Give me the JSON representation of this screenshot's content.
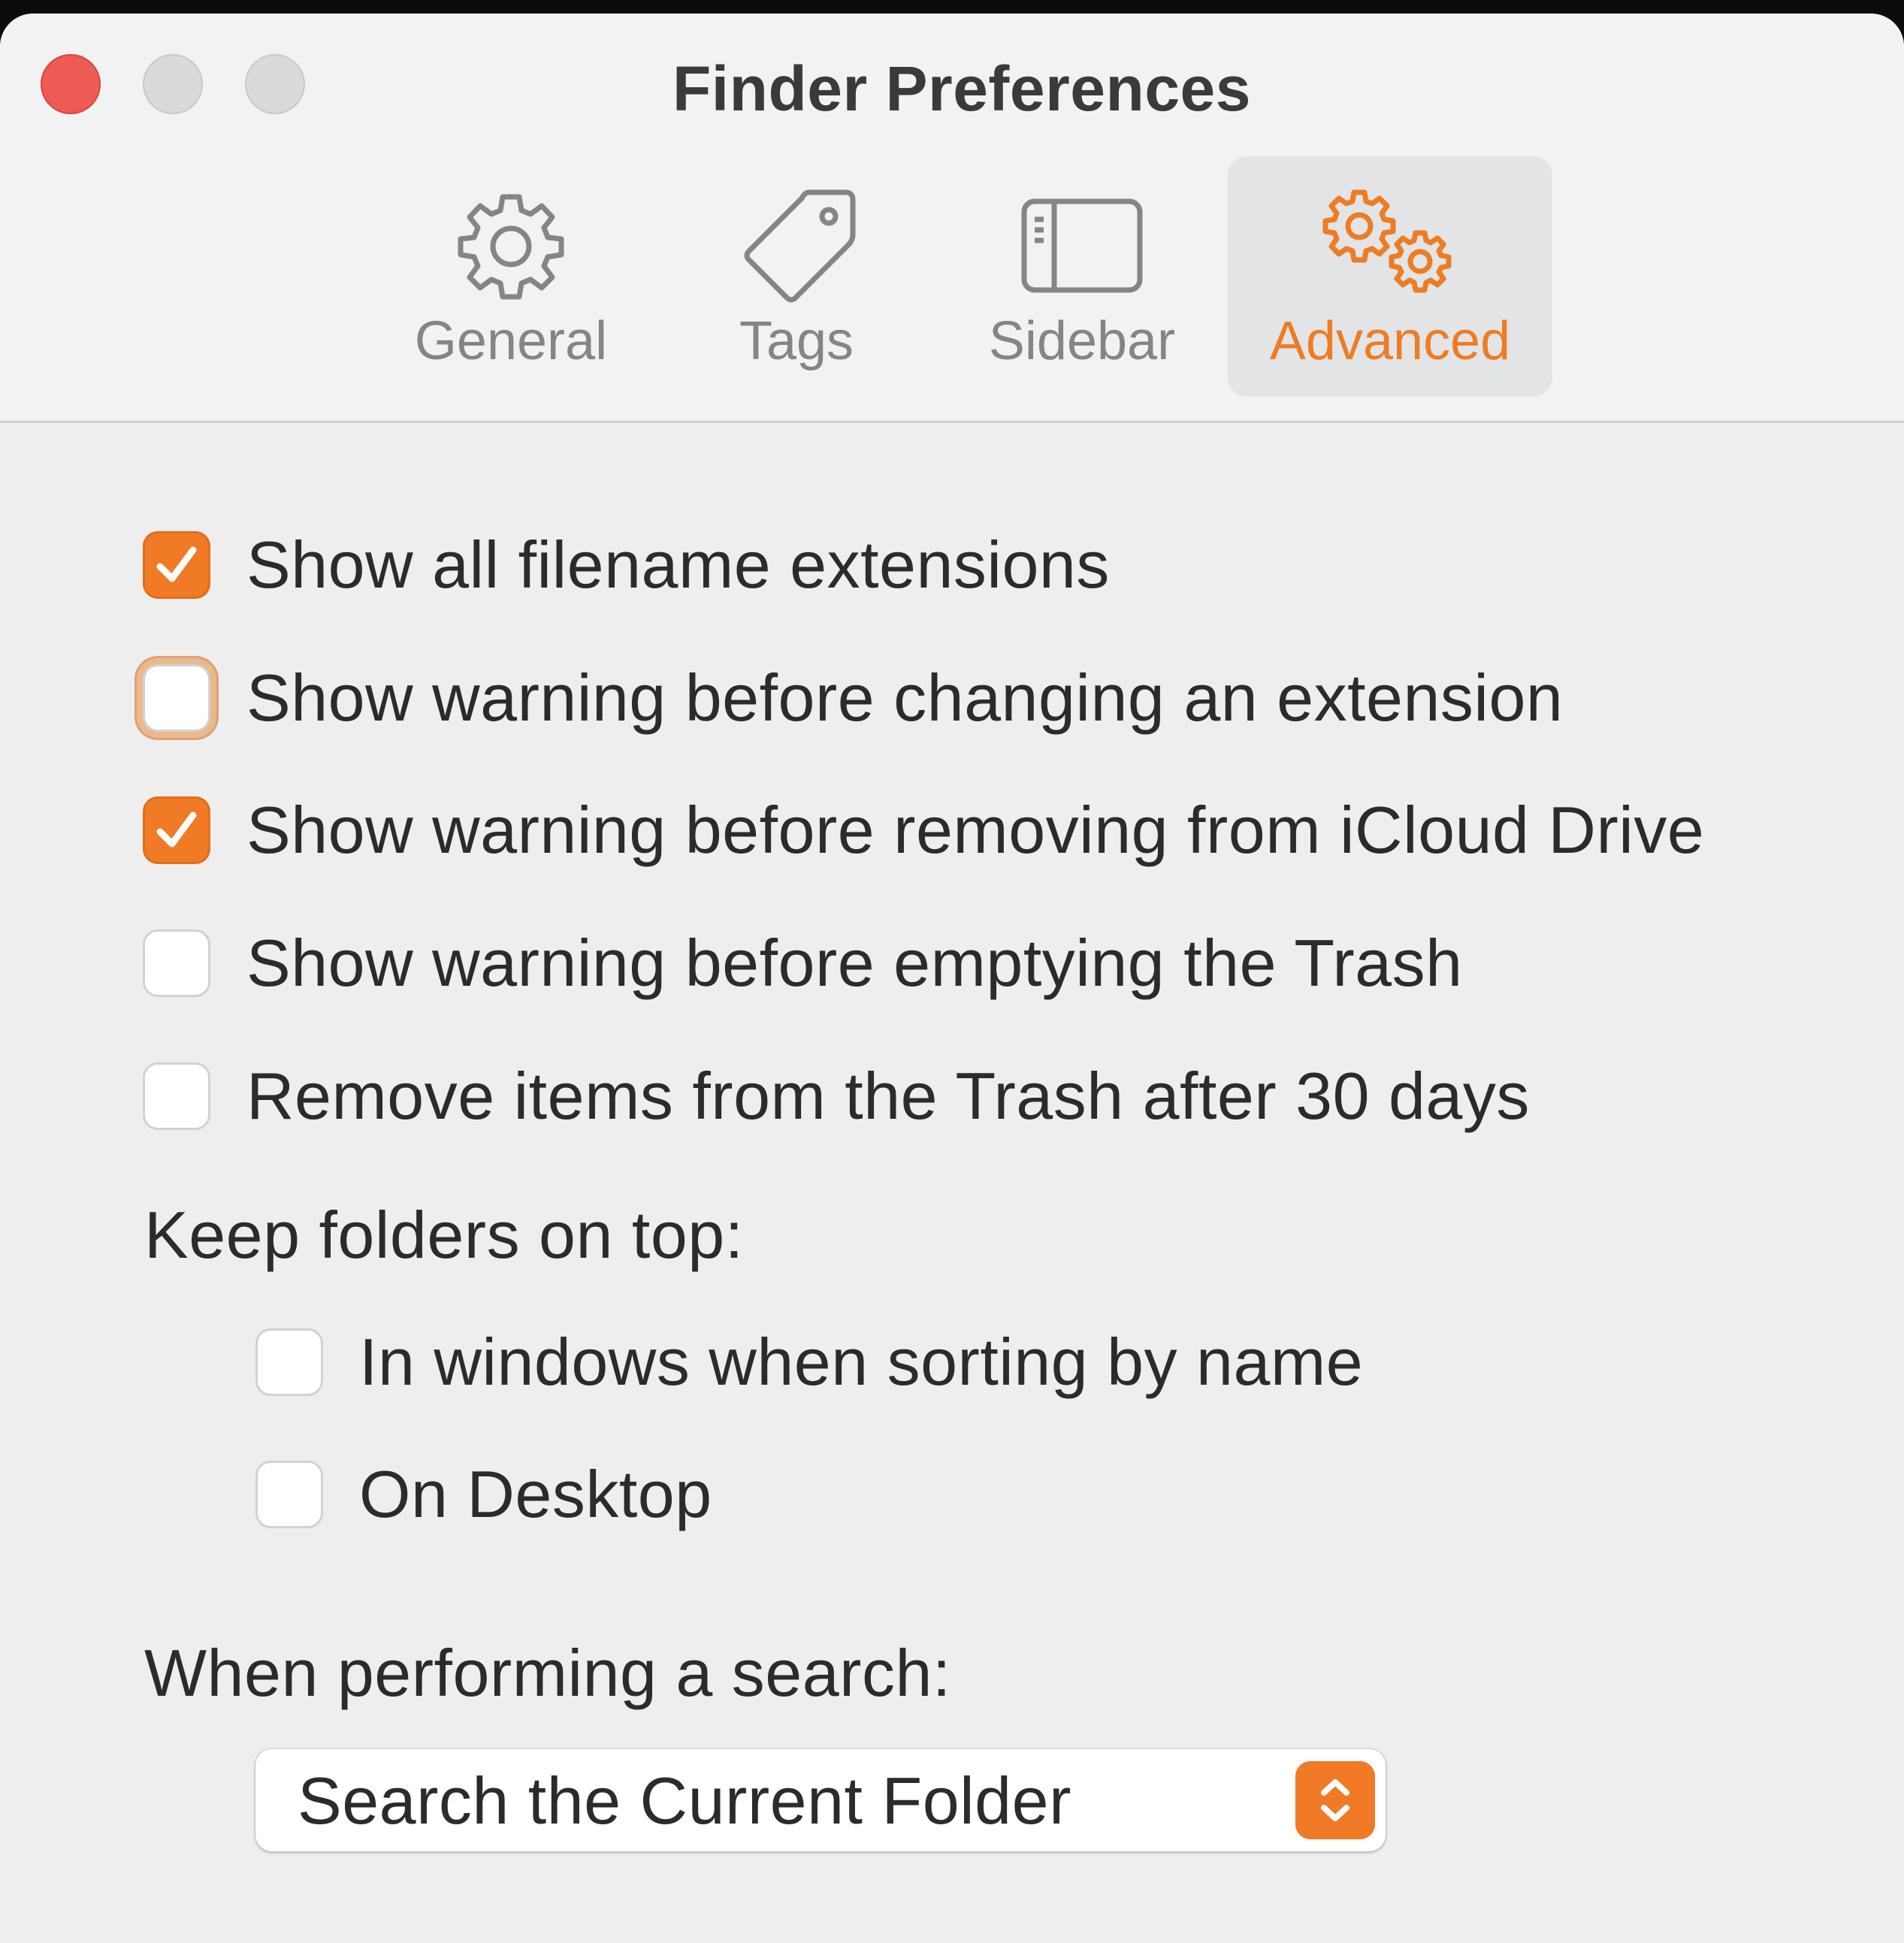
{
  "window": {
    "title": "Finder Preferences"
  },
  "toolbar": {
    "tabs": [
      {
        "label": "General",
        "icon": "gear-icon",
        "selected": false
      },
      {
        "label": "Tags",
        "icon": "tag-icon",
        "selected": false
      },
      {
        "label": "Sidebar",
        "icon": "sidebar-icon",
        "selected": false
      },
      {
        "label": "Advanced",
        "icon": "gears-icon",
        "selected": true
      }
    ]
  },
  "options": [
    {
      "label": "Show all filename extensions",
      "checked": true
    },
    {
      "label": "Show warning before changing an extension",
      "checked": false,
      "focused": true
    },
    {
      "label": "Show warning before removing from iCloud Drive",
      "checked": true
    },
    {
      "label": "Show warning before emptying the Trash",
      "checked": false
    },
    {
      "label": "Remove items from the Trash after 30 days",
      "checked": false
    }
  ],
  "keep_folders": {
    "heading": "Keep folders on top:",
    "options": [
      {
        "label": "In windows when sorting by name",
        "checked": false
      },
      {
        "label": "On Desktop",
        "checked": false
      }
    ]
  },
  "search": {
    "heading": "When performing a search:",
    "selected": "Search the Current Folder"
  },
  "colors": {
    "accent": "#f07a25",
    "close": "#ee5a55",
    "inactive_light": "#d9dadb"
  }
}
